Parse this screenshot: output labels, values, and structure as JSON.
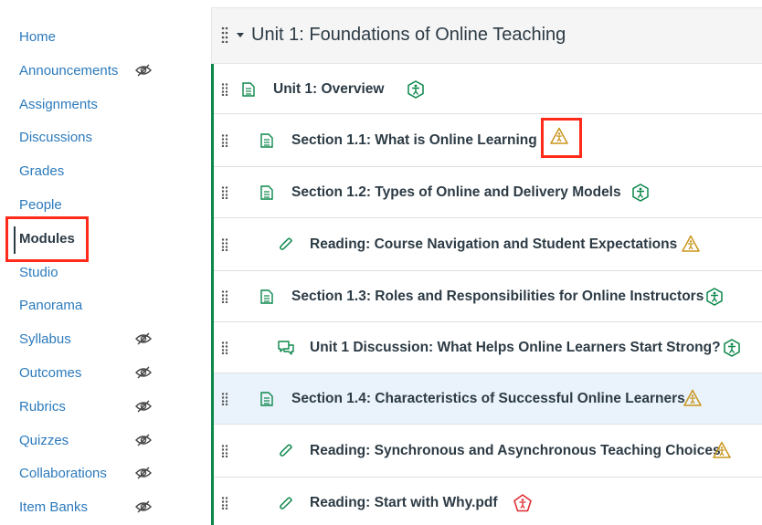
{
  "sidebar": {
    "items": [
      {
        "label": "Home",
        "hidden": false
      },
      {
        "label": "Announcements",
        "hidden": true
      },
      {
        "label": "Assignments",
        "hidden": false
      },
      {
        "label": "Discussions",
        "hidden": false
      },
      {
        "label": "Grades",
        "hidden": false
      },
      {
        "label": "People",
        "hidden": false
      },
      {
        "label": "Modules",
        "hidden": false,
        "active": true
      },
      {
        "label": "Studio",
        "hidden": false
      },
      {
        "label": "Panorama",
        "hidden": false
      },
      {
        "label": "Syllabus",
        "hidden": true
      },
      {
        "label": "Outcomes",
        "hidden": true
      },
      {
        "label": "Rubrics",
        "hidden": true
      },
      {
        "label": "Quizzes",
        "hidden": true
      },
      {
        "label": "Collaborations",
        "hidden": true
      },
      {
        "label": "Item Banks",
        "hidden": true
      }
    ]
  },
  "module": {
    "title": "Unit 1: Foundations of Online Teaching",
    "items": [
      {
        "title": "Unit 1: Overview",
        "type": "page-icon",
        "status": "accessible-icon"
      },
      {
        "title": "Section 1.1: What is Online Learning",
        "type": "page-icon",
        "status": "accessibility-warning-icon"
      },
      {
        "title": "Section 1.2: Types of Online and Delivery Models",
        "type": "page-icon",
        "status": "accessible-icon"
      },
      {
        "title": "Reading: Course Navigation and Student Expectations",
        "type": "attachment-icon",
        "status": "accessibility-warning-icon"
      },
      {
        "title": "Section 1.3: Roles and Responsibilities for Online Instructors",
        "type": "page-icon",
        "status": "accessible-icon"
      },
      {
        "title": "Unit 1 Discussion: What Helps Online Learners Start Strong?",
        "type": "discussion-icon",
        "status": "accessible-icon"
      },
      {
        "title": "Section 1.4: Characteristics of Successful Online Learners",
        "type": "page-icon",
        "status": "accessibility-warning-icon"
      },
      {
        "title": "Reading: Synchronous and Asynchronous Teaching Choices",
        "type": "attachment-icon",
        "status": "accessibility-warning-icon"
      },
      {
        "title": "Reading: Start with Why.pdf",
        "type": "attachment-icon",
        "status": "accessibility-error-icon"
      }
    ]
  },
  "colors": {
    "link": "#2b7abc",
    "text": "#2d3b45",
    "accent_green": "#0b874b",
    "warning": "#c9951a",
    "error": "#e0282e",
    "highlight_box": "#ff2a1a"
  }
}
